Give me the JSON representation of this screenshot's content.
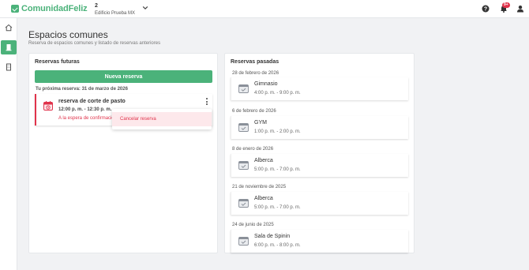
{
  "header": {
    "logo_text": "ComunidadFeliz",
    "building_number": "2",
    "building_name": "Edificio Prueba MX",
    "notification_badge": "9+"
  },
  "sidebar": {
    "items": [
      {
        "icon": "home-icon",
        "active": false
      },
      {
        "icon": "common-areas-icon",
        "active": true
      },
      {
        "icon": "building-icon",
        "active": false
      }
    ]
  },
  "page": {
    "title": "Espacios comunes",
    "subtitle": "Reserva de espacios comunes y listado de reservas anteriores"
  },
  "future": {
    "title": "Reservas futuras",
    "new_button": "Nueva reserva",
    "next_label": "Tu próxima reserva: 31 de marzo de 2026",
    "item": {
      "name": "reserva de corte de pasto",
      "time": "12:00 p. m. - 12:30 p. m.",
      "status": "A la espera de confirmación"
    },
    "menu": {
      "cancel_label": "Cancelar reserva"
    }
  },
  "past": {
    "title": "Reservas pasadas",
    "items": [
      {
        "date": "28 de febrero de 2026",
        "name": "Gimnasio",
        "time": "4:00 p. m. - 9:00 p. m."
      },
      {
        "date": "6 de febrero de 2026",
        "name": "GYM",
        "time": "1:00 p. m. - 2:00 p. m."
      },
      {
        "date": "8 de enero de 2026",
        "name": "Alberca",
        "time": "5:00 p. m. - 7:00 p. m."
      },
      {
        "date": "21 de noviembre de 2025",
        "name": "Alberca",
        "time": "5:00 p. m. - 7:00 p. m."
      },
      {
        "date": "24 de junio de 2025",
        "name": "Sala de Spinin",
        "time": "6:00 p. m. - 8:00 p. m."
      }
    ]
  },
  "colors": {
    "brand": "#4bb27a",
    "danger": "#e0334b"
  }
}
